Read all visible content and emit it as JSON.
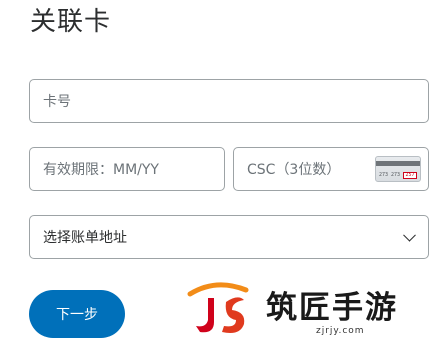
{
  "page": {
    "title": "关联卡"
  },
  "form": {
    "card_number_placeholder": "卡号",
    "expiry_placeholder": "有效期限：MM/YY",
    "csc_placeholder": "CSC（3位数）",
    "csc_card_numbers": "273 273",
    "csc_card_code": "257",
    "billing_address_label": "选择账单地址",
    "next_button_label": "下一步"
  },
  "watermark": {
    "brand_text": "筑匠手游",
    "domain_text": "zjrjy.com"
  },
  "colors": {
    "primary_button": "#0070ba",
    "field_border": "#9da3a6",
    "placeholder": "#6c7378"
  },
  "icons": {
    "csc_hint": "card-back-icon",
    "select_arrow": "chevron-down-icon"
  }
}
